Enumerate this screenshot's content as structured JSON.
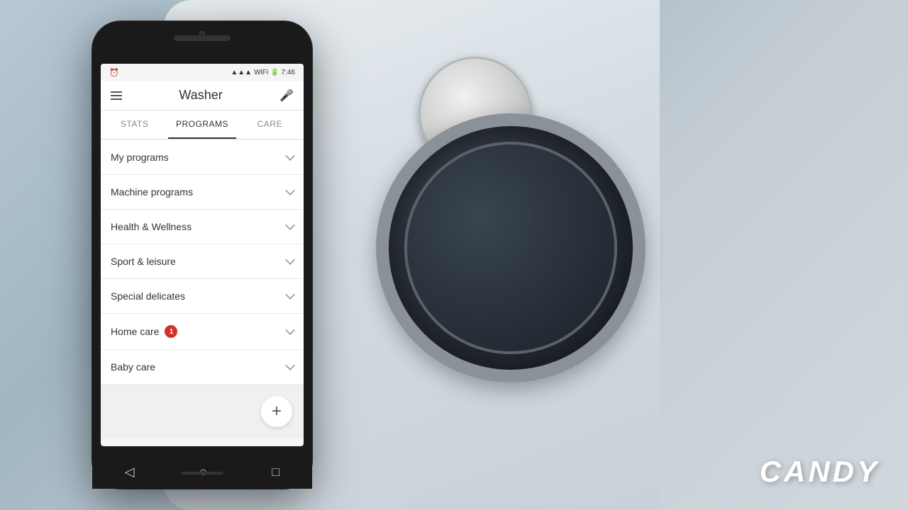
{
  "background": {
    "color_start": "#b8c8d4",
    "color_end": "#a0b5c2"
  },
  "brand": {
    "name": "CANDY"
  },
  "phone": {
    "status_bar": {
      "time": "7:46",
      "battery_icon": "🔋",
      "signal_icon": "📶",
      "wifi_icon": "🛜"
    },
    "header": {
      "menu_icon": "menu",
      "title": "Washer",
      "mic_icon": "mic"
    },
    "tabs": [
      {
        "label": "STATS",
        "active": false
      },
      {
        "label": "PROGRAMS",
        "active": true
      },
      {
        "label": "CARE",
        "active": false
      }
    ],
    "programs": [
      {
        "label": "My programs",
        "badge": null
      },
      {
        "label": "Machine programs",
        "badge": null
      },
      {
        "label": "Health & Wellness",
        "badge": null
      },
      {
        "label": "Sport & leisure",
        "badge": null
      },
      {
        "label": "Special delicates",
        "badge": null
      },
      {
        "label": "Home care",
        "badge": "1"
      },
      {
        "label": "Baby care",
        "badge": null
      }
    ],
    "add_button_label": "+",
    "bottom_nav": {
      "back": "◁",
      "home": "○",
      "recent": "□"
    }
  }
}
